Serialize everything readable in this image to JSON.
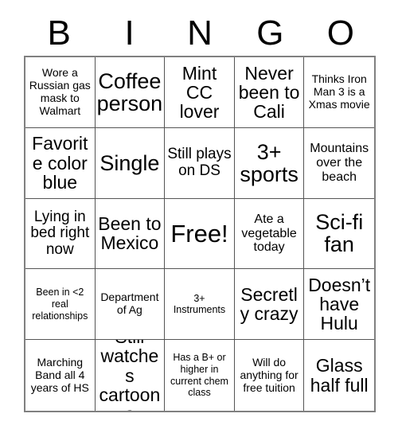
{
  "card": {
    "header_letters": [
      "B",
      "I",
      "N",
      "G",
      "O"
    ],
    "columns": 5,
    "rows": 5,
    "colors": {
      "background": "#ffffff",
      "text": "#000000",
      "grid_line": "#555555",
      "grid_border": "#808080"
    },
    "cells": [
      {
        "text": "Wore a Russian gas mask to Walmart",
        "size": "sm"
      },
      {
        "text": "Coffee person",
        "size": "xxl"
      },
      {
        "text": "Mint CC lover",
        "size": "xl"
      },
      {
        "text": "Never been to Cali",
        "size": "xl"
      },
      {
        "text": "Thinks Iron Man 3 is a Xmas movie",
        "size": "sm"
      },
      {
        "text": "Favorite color blue",
        "size": "xl"
      },
      {
        "text": "Single",
        "size": "xxl"
      },
      {
        "text": "Still plays on DS",
        "size": "lg"
      },
      {
        "text": "3+ sports",
        "size": "xxl"
      },
      {
        "text": "Mountains over the beach",
        "size": "md"
      },
      {
        "text": "Lying in bed right now",
        "size": "lg"
      },
      {
        "text": "Been to Mexico",
        "size": "xl"
      },
      {
        "text": "Free!",
        "size": "free"
      },
      {
        "text": "Ate a vegetable today",
        "size": "md"
      },
      {
        "text": "Sci-fi fan",
        "size": "xxl"
      },
      {
        "text": "Been in <2 real relationships",
        "size": "xs"
      },
      {
        "text": "Department of Ag",
        "size": "sm"
      },
      {
        "text": "3+ Instruments",
        "size": "xs"
      },
      {
        "text": "Secretly crazy",
        "size": "xl"
      },
      {
        "text": "Doesn’t have Hulu",
        "size": "xl"
      },
      {
        "text": "Marching Band all 4 years of HS",
        "size": "sm"
      },
      {
        "text": "Still watches cartoons",
        "size": "xl"
      },
      {
        "text": "Has a B+ or higher in current chem class",
        "size": "xs"
      },
      {
        "text": "Will do anything for free tuition",
        "size": "sm"
      },
      {
        "text": "Glass half full",
        "size": "xl"
      }
    ]
  }
}
